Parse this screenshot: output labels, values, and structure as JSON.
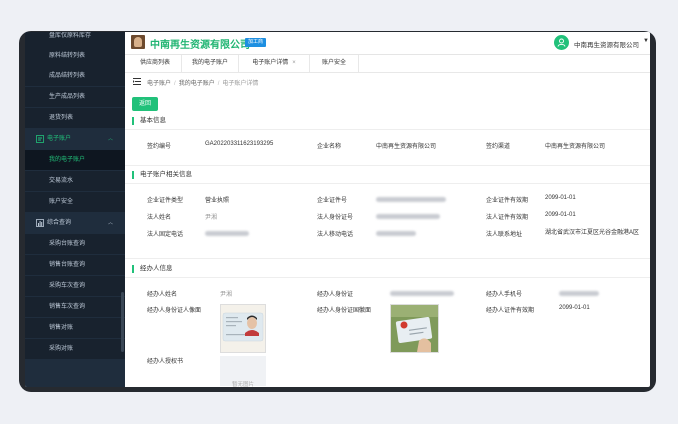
{
  "sidebar": {
    "items": [
      {
        "label": "盘库仅原料库存",
        "type": "sub"
      },
      {
        "label": "原料结转列表",
        "type": "sub"
      },
      {
        "label": "成品结转列表",
        "type": "sub"
      },
      {
        "label": "生产成品列表",
        "type": "sub"
      },
      {
        "label": "退货列表",
        "type": "sub"
      },
      {
        "label": "电子账户",
        "type": "group",
        "icon": "account-icon",
        "expanded": true
      },
      {
        "label": "我的电子账户",
        "type": "sub",
        "selected": true
      },
      {
        "label": "交易流水",
        "type": "sub"
      },
      {
        "label": "账户安全",
        "type": "sub"
      },
      {
        "label": "综合查询",
        "type": "group",
        "icon": "chart-icon",
        "expanded": true
      },
      {
        "label": "采购台账查询",
        "type": "sub"
      },
      {
        "label": "销售台账查询",
        "type": "sub"
      },
      {
        "label": "采购车次查询",
        "type": "sub"
      },
      {
        "label": "销售车次查询",
        "type": "sub"
      },
      {
        "label": "销售对账",
        "type": "sub"
      },
      {
        "label": "采购对账",
        "type": "sub"
      }
    ]
  },
  "header": {
    "company": "中南再生资源有限公司",
    "badge": "加工商",
    "user": "中南再生资源有限公司"
  },
  "tabs": [
    {
      "label": "供应商列表",
      "active": false
    },
    {
      "label": "我的电子账户",
      "active": false
    },
    {
      "label": "电子账户详情",
      "active": true,
      "closable": true
    },
    {
      "label": "账户安全",
      "active": false
    }
  ],
  "breadcrumb": [
    "电子账户",
    "我的电子账户",
    "电子账户详情"
  ],
  "back_button": "返回",
  "basic": {
    "title": "基本信息",
    "sign_no_label": "签约编号",
    "sign_no": "GA202203311623193295",
    "company_label": "企业名称",
    "company": "中南再生资源有限公司",
    "channel_label": "签约渠道",
    "channel": "中南再生资源有限公司"
  },
  "account": {
    "title": "电子账户相关信息",
    "cert_type_label": "企业证件类型",
    "cert_type": "营业执照",
    "cert_no_label": "企业证件号",
    "cert_valid_label": "企业证件有效期",
    "cert_valid": "2099-01-01",
    "legal_name_label": "法人姓名",
    "legal_name": "尹湘",
    "legal_id_label": "法人身份证号",
    "legal_valid_label": "法人证件有效期",
    "legal_valid": "2099-01-01",
    "legal_phone_label": "法人固定电话",
    "legal_mobile_label": "法人移动电话",
    "legal_addr_label": "法人联系地址",
    "legal_addr": "湖北省武汉市江夏区光谷金融港A区"
  },
  "agent": {
    "title": "经办人信息",
    "name_label": "经办人姓名",
    "name": "尹湘",
    "id_label": "经办人身份证",
    "phone_label": "经办人手机号",
    "front_label": "经办人身份证人像面",
    "back_label": "经办人身份证国徽面",
    "valid_label": "经办人证件有效期",
    "valid": "2099-01-01",
    "auth_label": "经办人授权书",
    "auth_empty": "暂无图片"
  }
}
